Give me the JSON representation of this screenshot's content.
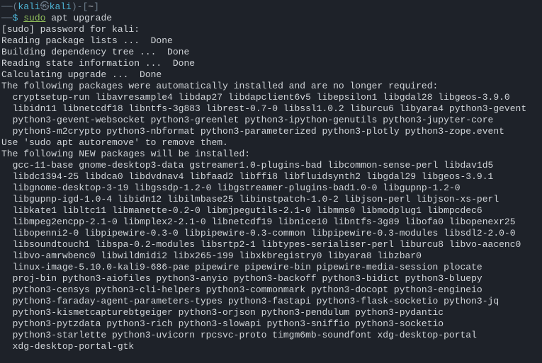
{
  "prompt": {
    "dash1": "──(",
    "user": "kali",
    "at": "㉿",
    "host": "kali",
    "close_paren": ")-[",
    "cwd": "~",
    "close_bracket": "]",
    "dash2": "──",
    "symbol": "$ ",
    "cmd_sudo": "sudo",
    "cmd_rest": " apt upgrade"
  },
  "lines": [
    "[sudo] password for kali:",
    "Reading package lists ...  Done",
    "Building dependency tree ...  Done",
    "Reading state information ...  Done",
    "Calculating upgrade ...  Done",
    "The following packages were automatically installed and are no longer required:",
    "  cryptsetup-run libavresample4 libdap27 libdapclient6v5 libepsilon1 libgdal28 libgeos-3.9.0",
    "  libidn11 libnetcdf18 libntfs-3g883 librest-0.7-0 libssl1.0.2 liburcu6 libyara4 python3-gevent",
    "  python3-gevent-websocket python3-greenlet python3-ipython-genutils python3-jupyter-core",
    "  python3-m2crypto python3-nbformat python3-parameterized python3-plotly python3-zope.event",
    "Use 'sudo apt autoremove' to remove them.",
    "The following NEW packages will be installed:",
    "  gcc-11-base gnome-desktop3-data gstreamer1.0-plugins-bad libcommon-sense-perl libdav1d5",
    "  libdc1394-25 libdca0 libdvdnav4 libfaad2 libffi8 libfluidsynth2 libgdal29 libgeos-3.9.1",
    "  libgnome-desktop-3-19 libgssdp-1.2-0 libgstreamer-plugins-bad1.0-0 libgupnp-1.2-0",
    "  libgupnp-igd-1.0-4 libidn12 libilmbase25 libinstpatch-1.0-2 libjson-perl libjson-xs-perl",
    "  libkate1 libltc11 libmanette-0.2-0 libmjpegutils-2.1-0 libmms0 libmodplug1 libmpcdec6",
    "  libmpeg2encpp-2.1-0 libmplex2-2.1-0 libnetcdf19 libnice10 libntfs-3g89 libofa0 libopenexr25",
    "  libopenni2-0 libpipewire-0.3-0 libpipewire-0.3-common libpipewire-0.3-modules libsdl2-2.0-0",
    "  libsoundtouch1 libspa-0.2-modules libsrtp2-1 libtypes-serialiser-perl liburcu8 libvo-aacenc0",
    "  libvo-amrwbenc0 libwildmidi2 libx265-199 libxkbregistry0 libyara8 libzbar0",
    "  linux-image-5.10.0-kali9-686-pae pipewire pipewire-bin pipewire-media-session plocate",
    "  proj-bin python3-aiofiles python3-anyio python3-backoff python3-bidict python3-bluepy",
    "  python3-censys python3-cli-helpers python3-commonmark python3-docopt python3-engineio",
    "  python3-faraday-agent-parameters-types python3-fastapi python3-flask-socketio python3-jq",
    "  python3-kismetcapturebtgeiger python3-orjson python3-pendulum python3-pydantic",
    "  python3-pytzdata python3-rich python3-slowapi python3-sniffio python3-socketio",
    "  python3-starlette python3-uvicorn rpcsvc-proto timgm6mb-soundfont xdg-desktop-portal",
    "  xdg-desktop-portal-gtk"
  ]
}
